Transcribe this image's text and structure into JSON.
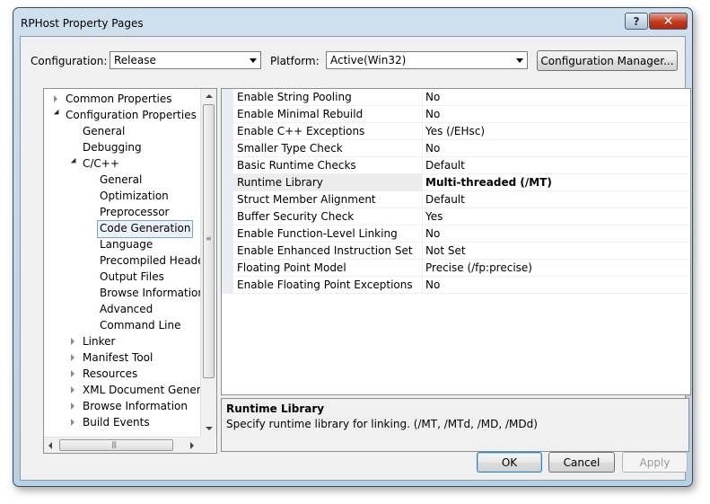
{
  "window": {
    "title": "RPHost Property Pages",
    "help_glyph": "?",
    "close_glyph": "✕"
  },
  "header": {
    "configuration_label": "Configuration:",
    "configuration_value": "Release",
    "platform_label": "Platform:",
    "platform_value": "Active(Win32)",
    "config_manager_label": "Configuration Manager..."
  },
  "tree": {
    "items": [
      {
        "label": "Common Properties"
      },
      {
        "label": "Configuration Properties"
      },
      {
        "label": "General"
      },
      {
        "label": "Debugging"
      },
      {
        "label": "C/C++"
      },
      {
        "label": "General"
      },
      {
        "label": "Optimization"
      },
      {
        "label": "Preprocessor"
      },
      {
        "label": "Code Generation"
      },
      {
        "label": "Language"
      },
      {
        "label": "Precompiled Heade"
      },
      {
        "label": "Output Files"
      },
      {
        "label": "Browse Information"
      },
      {
        "label": "Advanced"
      },
      {
        "label": "Command Line"
      },
      {
        "label": "Linker"
      },
      {
        "label": "Manifest Tool"
      },
      {
        "label": "Resources"
      },
      {
        "label": "XML Document Genera"
      },
      {
        "label": "Browse Information"
      },
      {
        "label": "Build Events"
      }
    ]
  },
  "properties": [
    {
      "name": "Enable String Pooling",
      "value": "No"
    },
    {
      "name": "Enable Minimal Rebuild",
      "value": "No"
    },
    {
      "name": "Enable C++ Exceptions",
      "value": "Yes (/EHsc)"
    },
    {
      "name": "Smaller Type Check",
      "value": "No"
    },
    {
      "name": "Basic Runtime Checks",
      "value": "Default"
    },
    {
      "name": "Runtime Library",
      "value": "Multi-threaded (/MT)"
    },
    {
      "name": "Struct Member Alignment",
      "value": "Default"
    },
    {
      "name": "Buffer Security Check",
      "value": "Yes"
    },
    {
      "name": "Enable Function-Level Linking",
      "value": "No"
    },
    {
      "name": "Enable Enhanced Instruction Set",
      "value": "Not Set"
    },
    {
      "name": "Floating Point Model",
      "value": "Precise (/fp:precise)"
    },
    {
      "name": "Enable Floating Point Exceptions",
      "value": "No"
    }
  ],
  "description": {
    "title": "Runtime Library",
    "text": "Specify runtime library for linking.     (/MT, /MTd, /MD, /MDd)"
  },
  "buttons": {
    "ok": "OK",
    "cancel": "Cancel",
    "apply": "Apply"
  }
}
